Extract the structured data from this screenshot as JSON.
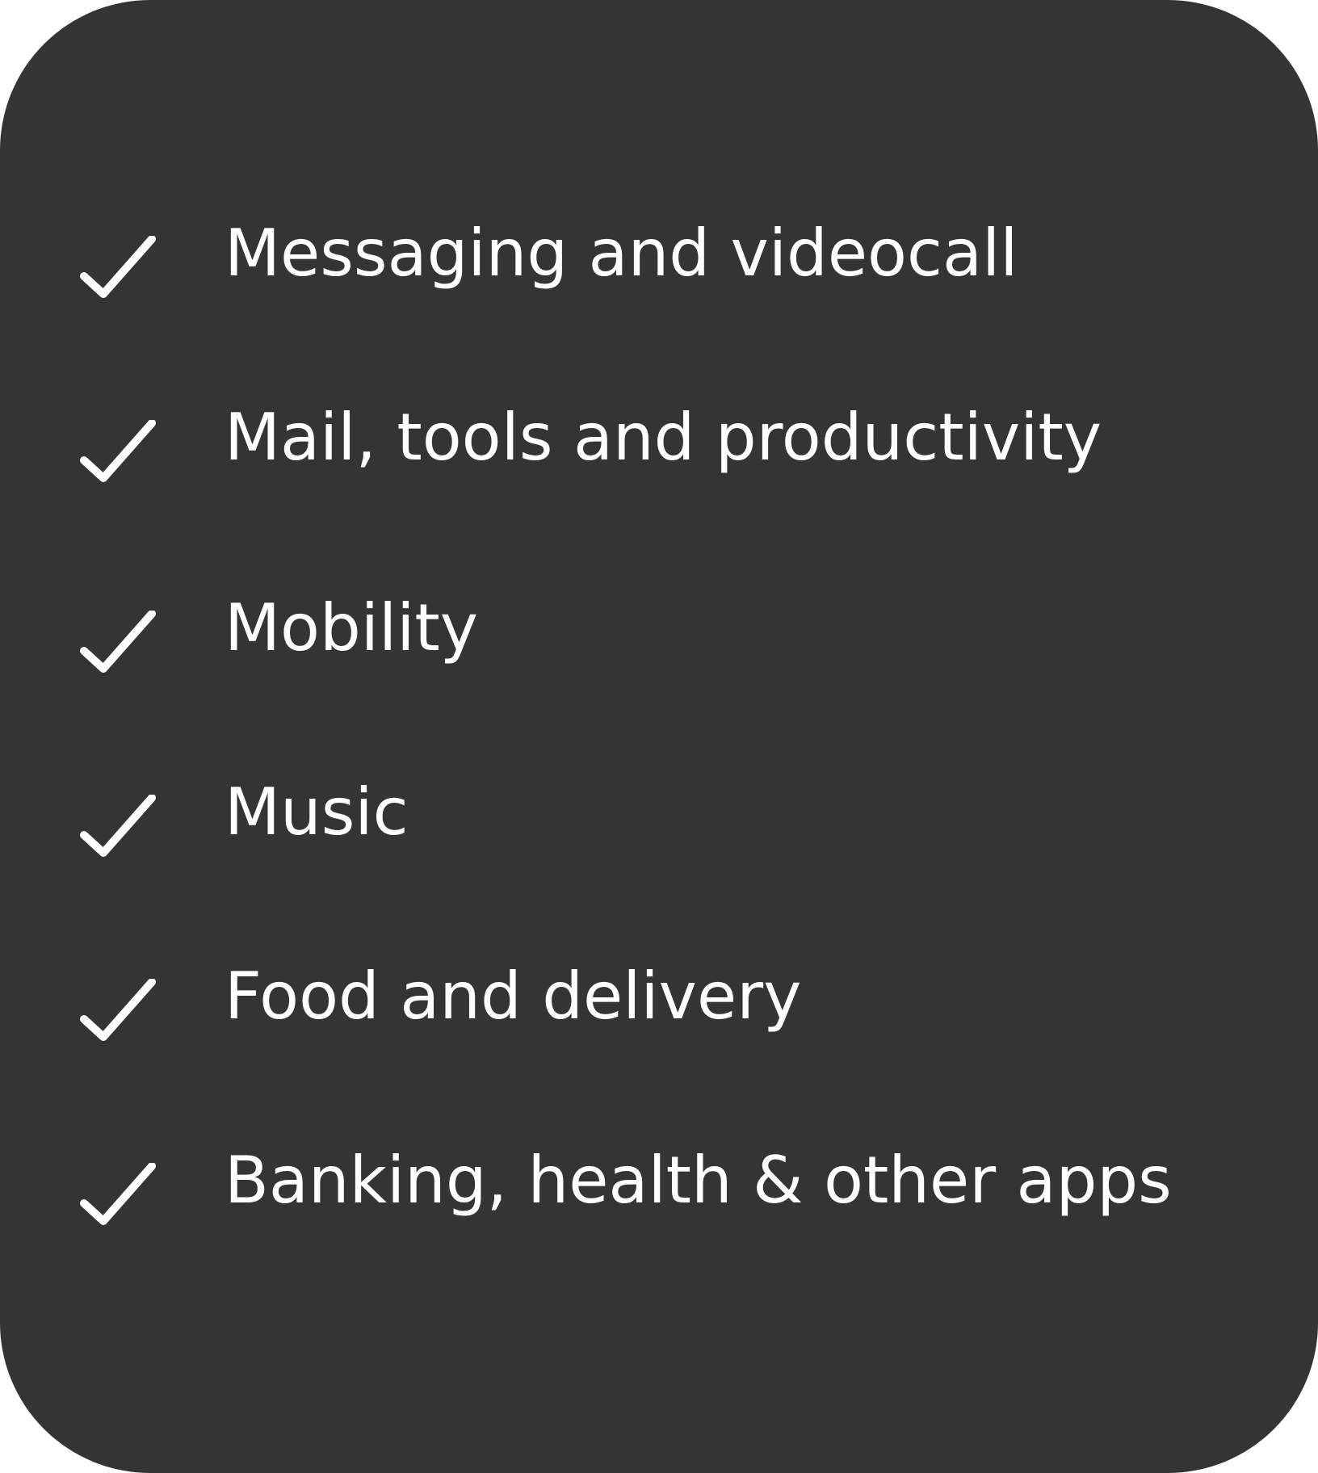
{
  "card": {
    "background_color": "#343434",
    "text_color": "#ffffff",
    "items": [
      {
        "label": "Messaging and videocall",
        "icon": "check-icon"
      },
      {
        "label": "Mail, tools and productivity",
        "icon": "check-icon"
      },
      {
        "label": "Mobility",
        "icon": "check-icon"
      },
      {
        "label": "Music",
        "icon": "check-icon"
      },
      {
        "label": "Food and delivery",
        "icon": "check-icon"
      },
      {
        "label": "Banking, health & other apps",
        "icon": "check-icon"
      }
    ]
  }
}
